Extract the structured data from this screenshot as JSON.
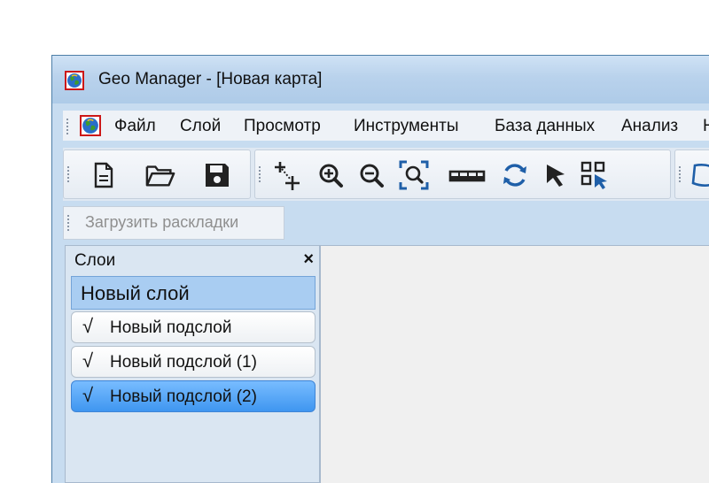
{
  "window": {
    "title": "Geo Manager - [Новая карта]"
  },
  "menu": {
    "items": [
      "Файл",
      "Слой",
      "Просмотр",
      "Инструменты",
      "База данных",
      "Анализ",
      "Н"
    ]
  },
  "toolbar": {
    "buttons": [
      "new-document-icon",
      "open-folder-icon",
      "save-icon",
      "add-point-icon",
      "zoom-in-icon",
      "zoom-out-icon",
      "zoom-extent-icon",
      "measure-icon",
      "refresh-icon",
      "select-arrow-icon",
      "select-grid-icon"
    ]
  },
  "layouts": {
    "load_label": "Загрузить раскладки"
  },
  "layers_panel": {
    "title": "Слои",
    "close": "×",
    "layer": "Новый слой",
    "sublayers": [
      {
        "label": "Новый подслой",
        "checked": true,
        "selected": false
      },
      {
        "label": "Новый подслой (1)",
        "checked": true,
        "selected": false
      },
      {
        "label": "Новый подслой (2)",
        "checked": true,
        "selected": true
      }
    ],
    "check_glyph": "√"
  },
  "colors": {
    "accent": "#3f96f0",
    "layer_header": "#a9cdf2",
    "chrome": "#c7dcf0"
  }
}
